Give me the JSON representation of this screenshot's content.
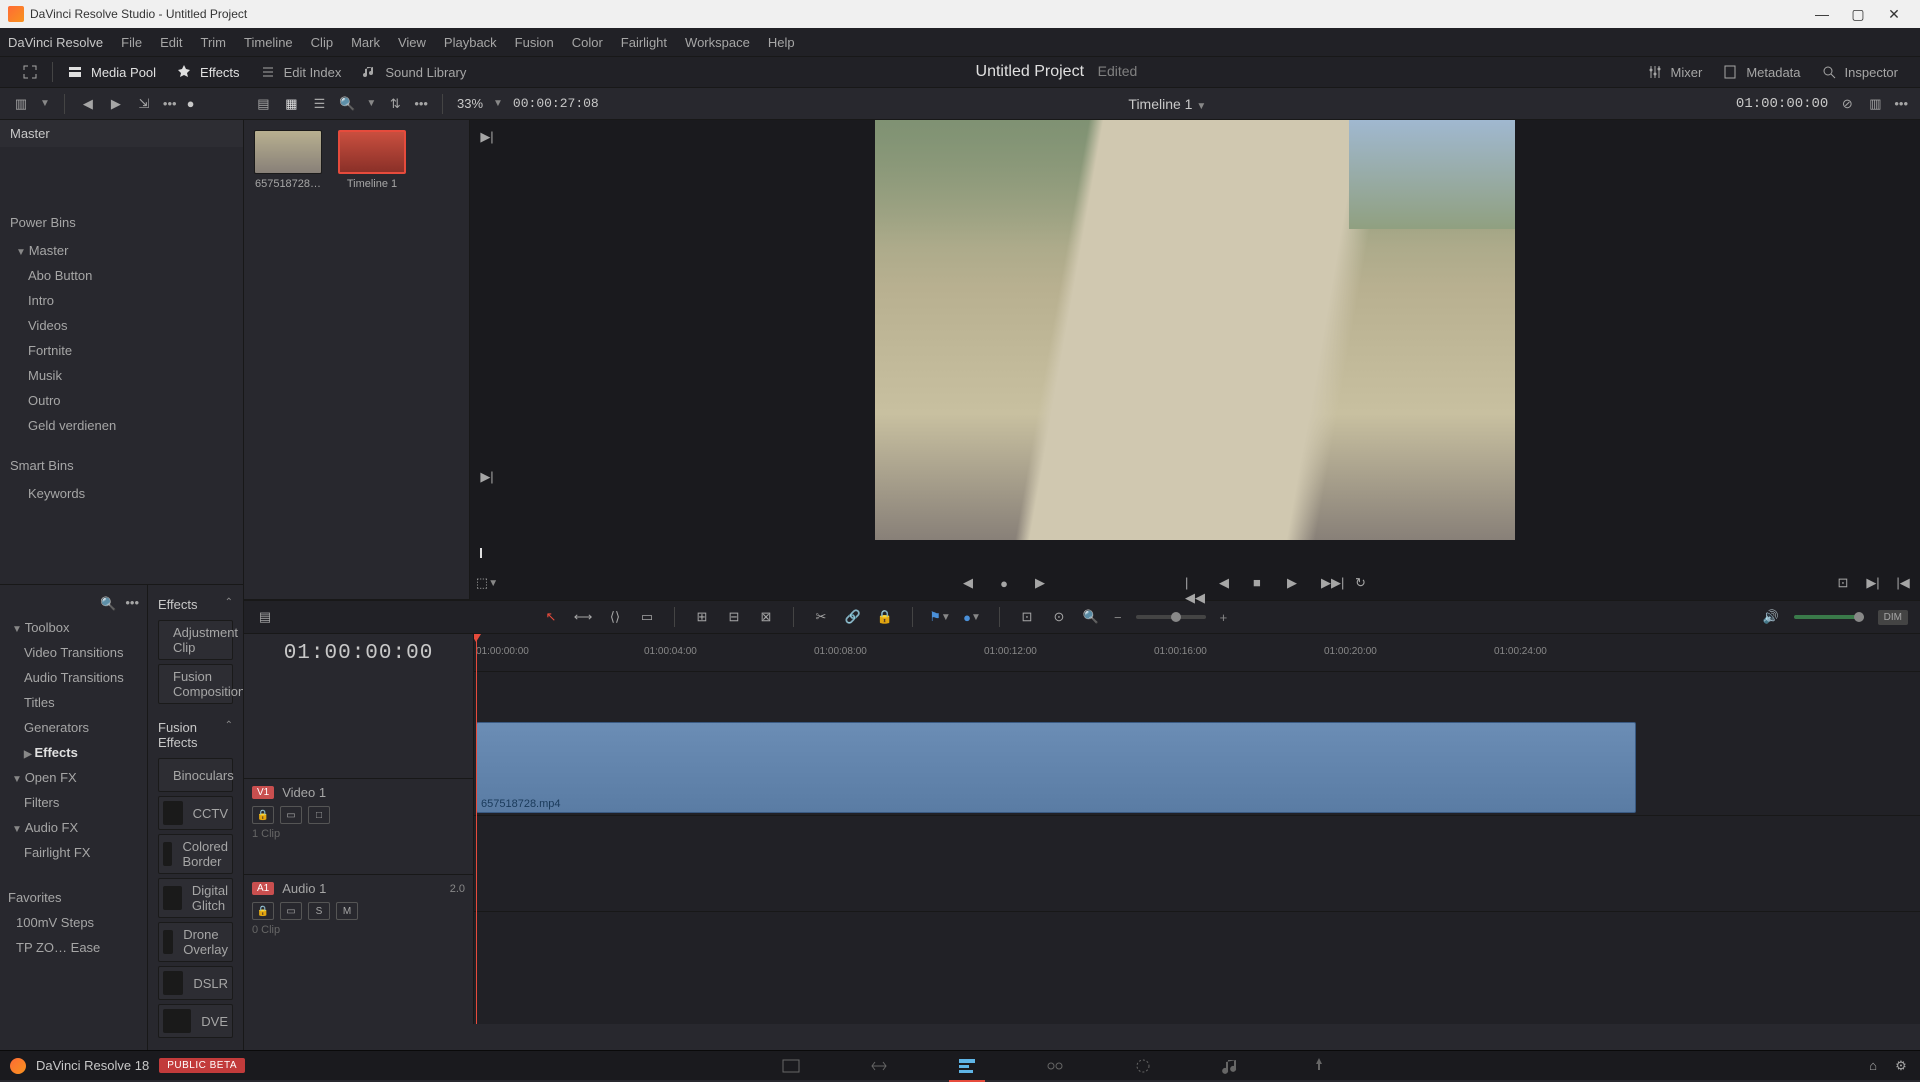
{
  "window": {
    "title": "DaVinci Resolve Studio - Untitled Project"
  },
  "menubar": {
    "app": "DaVinci Resolve",
    "items": [
      "File",
      "Edit",
      "Trim",
      "Timeline",
      "Clip",
      "Mark",
      "View",
      "Playback",
      "Fusion",
      "Color",
      "Fairlight",
      "Workspace",
      "Help"
    ]
  },
  "toolbar": {
    "media_pool": "Media Pool",
    "effects": "Effects",
    "edit_index": "Edit Index",
    "sound_library": "Sound Library",
    "project_title": "Untitled Project",
    "project_status": "Edited",
    "mixer": "Mixer",
    "metadata": "Metadata",
    "inspector": "Inspector"
  },
  "subbar": {
    "zoom": "33%",
    "duration": "00:00:27:08",
    "timeline_name": "Timeline 1",
    "timeline_tc": "01:00:00:00"
  },
  "bins": {
    "master": "Master",
    "power_bins": "Power Bins",
    "power_master": "Master",
    "items": [
      "Abo Button",
      "Intro",
      "Videos",
      "Fortnite",
      "Musik",
      "Outro",
      "Geld verdienen"
    ],
    "smart_bins": "Smart Bins",
    "keywords": "Keywords"
  },
  "clips": [
    {
      "name": "657518728…"
    },
    {
      "name": "Timeline 1"
    }
  ],
  "effects_cats": {
    "toolbox": "Toolbox",
    "video_transitions": "Video Transitions",
    "audio_transitions": "Audio Transitions",
    "titles": "Titles",
    "generators": "Generators",
    "effects": "Effects",
    "openfx": "Open FX",
    "filters": "Filters",
    "audiofx": "Audio FX",
    "fairlight": "Fairlight FX",
    "favorites": "Favorites",
    "fav1": "100mV Steps",
    "fav2": "TP ZO… Ease"
  },
  "effects_panel": {
    "group1": "Effects",
    "i1": "Adjustment Clip",
    "i2": "Fusion Composition",
    "group2": "Fusion Effects",
    "f1": "Binoculars",
    "f2": "CCTV",
    "f3": "Colored Border",
    "f4": "Digital Glitch",
    "f5": "Drone Overlay",
    "f6": "DSLR",
    "f7": "DVE"
  },
  "timeline": {
    "tc": "01:00:00:00",
    "v1_tag": "V1",
    "v1_name": "Video 1",
    "v1_meta": "1 Clip",
    "a1_tag": "A1",
    "a1_name": "Audio 1",
    "a1_ch": "2.0",
    "a1_meta": "0 Clip",
    "clip_name": "657518728.mp4",
    "s_btn": "S",
    "m_btn": "M",
    "ticks": [
      "01:00:00:00",
      "01:00:04:00",
      "01:00:08:00",
      "01:00:12:00",
      "01:00:16:00",
      "01:00:20:00",
      "01:00:24:00"
    ]
  },
  "bottombar": {
    "version": "DaVinci Resolve 18",
    "badge": "PUBLIC BETA"
  }
}
